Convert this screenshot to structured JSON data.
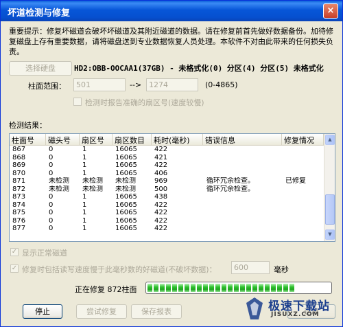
{
  "window": {
    "title": "坏道检测与修复",
    "close_label": "×"
  },
  "notice": {
    "text": "重要提示：修复坏磁道会破坏坏磁道及其附近磁道的数据。请在修复前首先做好数据备份。加待修复磁盘上存有重要数据，请将磁盘送到专业数据恢复人员处理。本软件不对由此带来的任何损失负责。"
  },
  "disk": {
    "select_label": "选择硬盘",
    "info": "HD2:OBB-OOCAA1(37GB) - 未格式化(0) 分区(4) 分区(5) 未格式化"
  },
  "range": {
    "label": "柱面范围：",
    "start": "501",
    "arrow": "-->",
    "end": "1274",
    "hint": "(0-4865)"
  },
  "report_sector_checkbox": {
    "label": "检测时报告准确的扇区号(速度较慢)"
  },
  "results": {
    "label": "检测结果：",
    "columns": [
      "柱面号",
      "磁头号",
      "扇区号",
      "扇区数目",
      "耗时(毫秒)",
      "错误信息",
      "修复情况"
    ],
    "rows": [
      [
        "867",
        "0",
        "1",
        "16065",
        "422",
        "",
        ""
      ],
      [
        "868",
        "0",
        "1",
        "16065",
        "421",
        "",
        ""
      ],
      [
        "869",
        "0",
        "1",
        "16065",
        "422",
        "",
        ""
      ],
      [
        "870",
        "0",
        "1",
        "16065",
        "406",
        "",
        ""
      ],
      [
        "871",
        "未检测",
        "未检测",
        "未检测",
        "969",
        "循环冗余检查。",
        "已修复"
      ],
      [
        "872",
        "未检测",
        "未检测",
        "未检测",
        "500",
        "循环冗余检查。",
        ""
      ],
      [
        "873",
        "0",
        "1",
        "16065",
        "438",
        "",
        ""
      ],
      [
        "874",
        "0",
        "1",
        "16065",
        "422",
        "",
        ""
      ],
      [
        "875",
        "0",
        "1",
        "16065",
        "422",
        "",
        ""
      ],
      [
        "876",
        "0",
        "1",
        "16065",
        "422",
        "",
        ""
      ],
      [
        "877",
        "0",
        "1",
        "16065",
        "422",
        "",
        ""
      ]
    ]
  },
  "options": {
    "show_normal_label": "显示正常磁道",
    "slow_track_label": "修复时包括读写速度慢于此毫秒数的好磁道(不破坏数据)：",
    "slow_track_value": "600",
    "slow_track_unit": "毫秒"
  },
  "status": {
    "text": "正在修复 872柱面",
    "progress": 0.84
  },
  "buttons": {
    "stop": "停止",
    "try_repair": "尝试修复",
    "save_report": "保存报表",
    "exit": "退出"
  },
  "watermark": {
    "title": "极速下载站",
    "url": "JISUXZ.COM"
  }
}
